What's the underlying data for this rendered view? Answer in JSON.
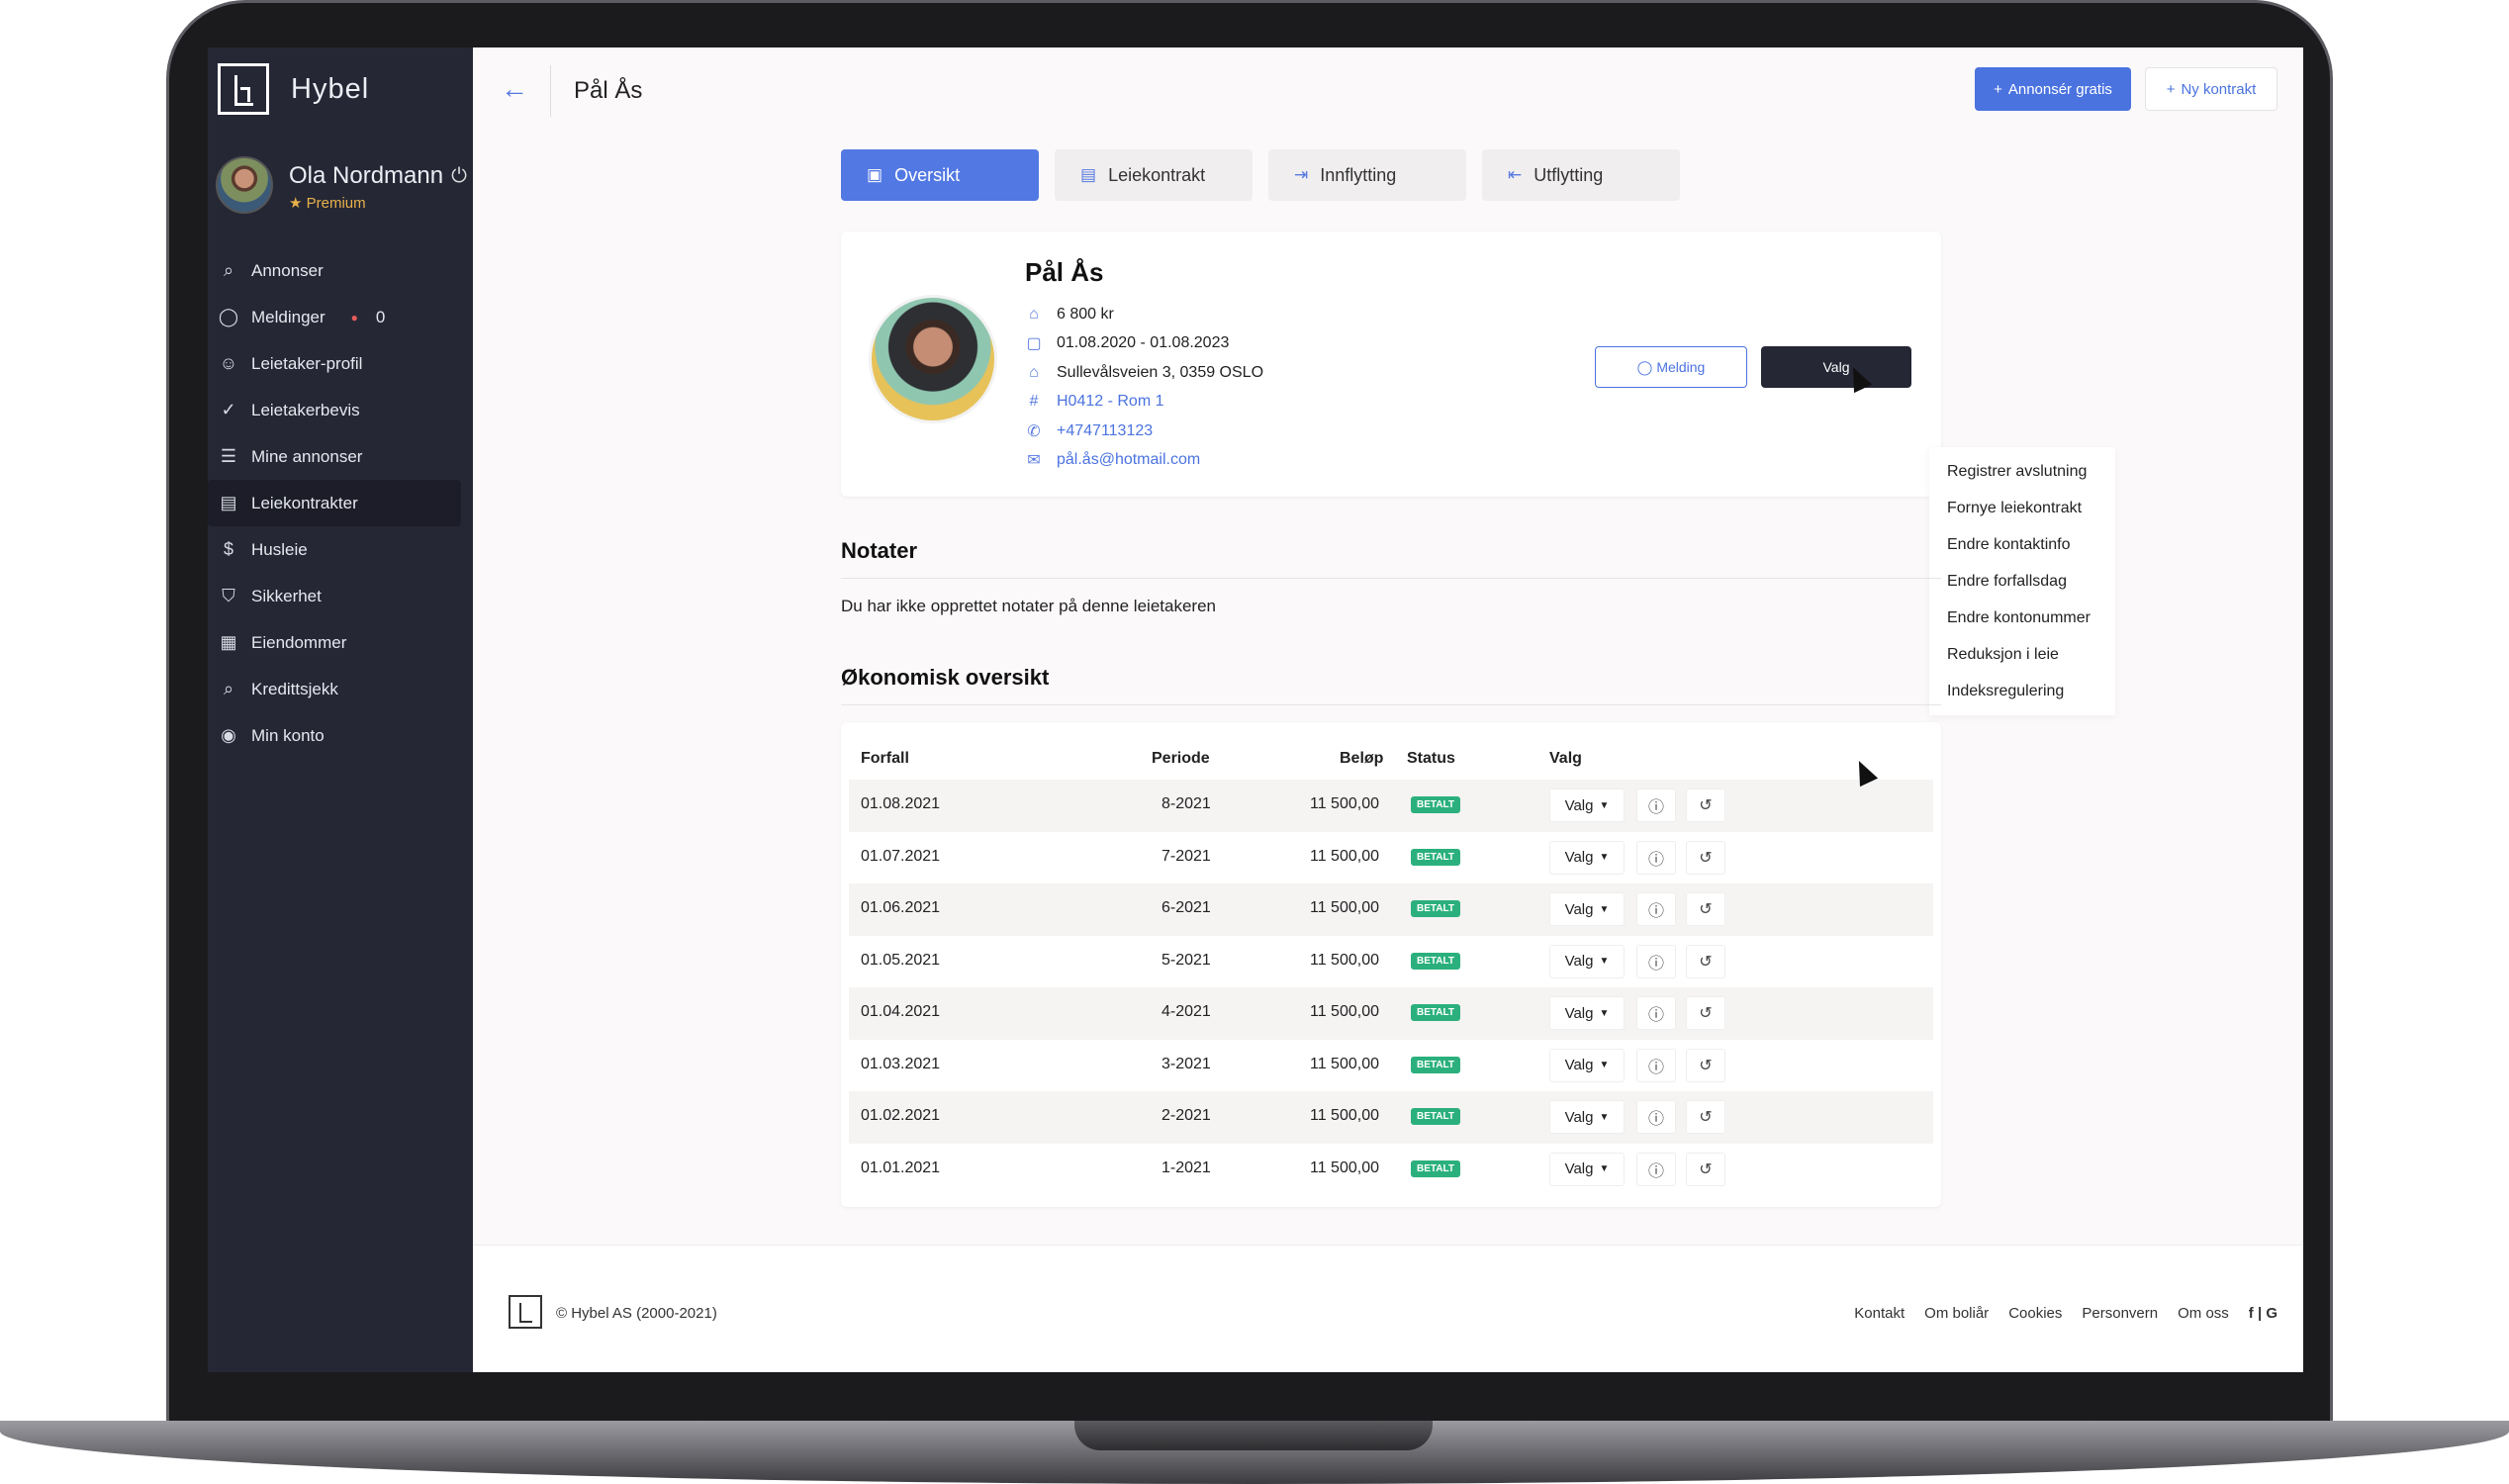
{
  "app": {
    "name": "Hybel"
  },
  "user": {
    "name": "Ola Nordmann",
    "plan": "Premium"
  },
  "sidebar": {
    "items": [
      {
        "label": "Annonser",
        "icon": "search-icon"
      },
      {
        "label": "Meldinger",
        "icon": "chat-icon",
        "count": "0"
      },
      {
        "label": "Leietaker-profil",
        "icon": "user-icon"
      },
      {
        "label": "Leietakerbevis",
        "icon": "check-circle-icon"
      },
      {
        "label": "Mine annonser",
        "icon": "list-icon"
      },
      {
        "label": "Leiekontrakter",
        "icon": "document-icon",
        "active": true
      },
      {
        "label": "Husleie",
        "icon": "money-icon"
      },
      {
        "label": "Sikkerhet",
        "icon": "shield-icon"
      },
      {
        "label": "Eiendommer",
        "icon": "building-icon"
      },
      {
        "label": "Kredittsjekk",
        "icon": "magnifier-icon"
      },
      {
        "label": "Min konto",
        "icon": "account-icon"
      }
    ]
  },
  "header": {
    "title": "Pål Ås",
    "primary_button": "Annonsér gratis",
    "secondary_button": "Ny kontrakt"
  },
  "tabs": [
    {
      "label": "Oversikt",
      "active": true
    },
    {
      "label": "Leiekontrakt"
    },
    {
      "label": "Innflytting"
    },
    {
      "label": "Utflytting"
    }
  ],
  "tenant": {
    "name": "Pål Ås",
    "rent": "6 800 kr",
    "period": "01.08.2020 - 01.08.2023",
    "address": "Sullevålsveien 3, 0359 OSLO",
    "unit": "H0412 - Rom 1",
    "phone": "+4747113123",
    "email": "pål.ås@hotmail.com",
    "message_button": "Melding",
    "options_button": "Valg"
  },
  "options_menu": [
    "Registrer avslutning",
    "Fornye leiekontrakt",
    "Endre kontaktinfo",
    "Endre forfallsdag",
    "Endre kontonummer",
    "Reduksjon i leie",
    "Indeksregulering"
  ],
  "notes": {
    "title": "Notater",
    "empty_text": "Du har ikke opprettet notater på denne leietakeren"
  },
  "finance": {
    "title": "Økonomisk oversikt",
    "columns": {
      "due": "Forfall",
      "period": "Periode",
      "amount": "Beløp",
      "status": "Status",
      "options": "Valg"
    },
    "rows": [
      {
        "due": "01.08.2021",
        "period": "8-2021",
        "amount": "11 500,00",
        "status": "BETALT",
        "options": "Valg"
      },
      {
        "due": "01.07.2021",
        "period": "7-2021",
        "amount": "11 500,00",
        "status": "BETALT",
        "options": "Valg"
      },
      {
        "due": "01.06.2021",
        "period": "6-2021",
        "amount": "11 500,00",
        "status": "BETALT",
        "options": "Valg"
      },
      {
        "due": "01.05.2021",
        "period": "5-2021",
        "amount": "11 500,00",
        "status": "BETALT",
        "options": "Valg"
      },
      {
        "due": "01.04.2021",
        "period": "4-2021",
        "amount": "11 500,00",
        "status": "BETALT",
        "options": "Valg"
      },
      {
        "due": "01.03.2021",
        "period": "3-2021",
        "amount": "11 500,00",
        "status": "BETALT",
        "options": "Valg"
      },
      {
        "due": "01.02.2021",
        "period": "2-2021",
        "amount": "11 500,00",
        "status": "BETALT",
        "options": "Valg"
      },
      {
        "due": "01.01.2021",
        "period": "1-2021",
        "amount": "11 500,00",
        "status": "BETALT",
        "options": "Valg"
      }
    ]
  },
  "footer": {
    "copyright": "© Hybel AS (2000-2021)",
    "links": [
      "Kontakt",
      "Om boliår",
      "Cookies",
      "Personvern",
      "Om oss"
    ],
    "social": "f | G"
  },
  "colors": {
    "accent": "#4b73e0",
    "sidebar": "#252735",
    "status_paid": "#2bb07d"
  }
}
